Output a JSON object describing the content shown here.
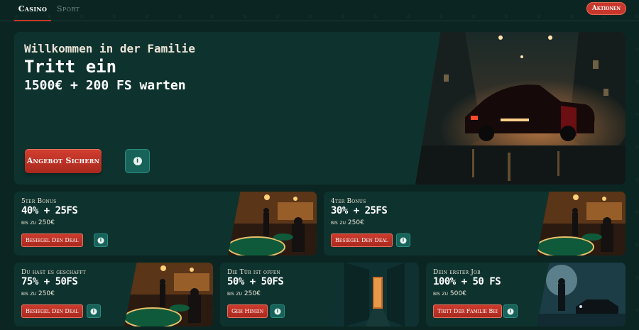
{
  "nav": {
    "tabs": [
      {
        "label": "Casino",
        "active": true
      },
      {
        "label": "Sport",
        "active": false
      }
    ],
    "aktionen_label": "Aktionen"
  },
  "hero": {
    "line1": "Willkommen in der Familie",
    "line2": "Tritt ein",
    "line3": "1500€ + 200 FS warten",
    "cta_label": "Angebot Sichern",
    "info_icon": "info-icon",
    "image": "black-classic-car-in-foggy-night-street"
  },
  "cards": [
    {
      "title": "5ter Bonus",
      "main": "40% + 25FS",
      "sub": "bis zu 250€",
      "cta": "Besiegel Den Deal",
      "image": "casino-roulette-room"
    },
    {
      "title": "4ter Bonus",
      "main": "30% + 25FS",
      "sub": "bis zu 250€",
      "cta": "Besiegel Den Deal",
      "image": "casino-roulette-room"
    },
    {
      "title": "Du hast es geschafft",
      "main": "75% + 50FS",
      "sub": "bis zu 250€",
      "cta": "Besiegel Den Deal",
      "image": "casino-roulette-room"
    },
    {
      "title": "Die Tür ist offen",
      "main": "50% + 50FS",
      "sub": "bis zu 250€",
      "cta": "Geh Hinein",
      "image": "dark-alley-door"
    },
    {
      "title": "Dein erster Job",
      "main": "100% + 50 FS",
      "sub": "bis zu 500€",
      "cta": "Tritt Der Familie Bei",
      "image": "man-in-foggy-street-with-car"
    }
  ],
  "colors": {
    "background": "#0b2622",
    "card": "#0e332f",
    "accent_red": "#c8372b",
    "info_teal": "#17635a"
  }
}
